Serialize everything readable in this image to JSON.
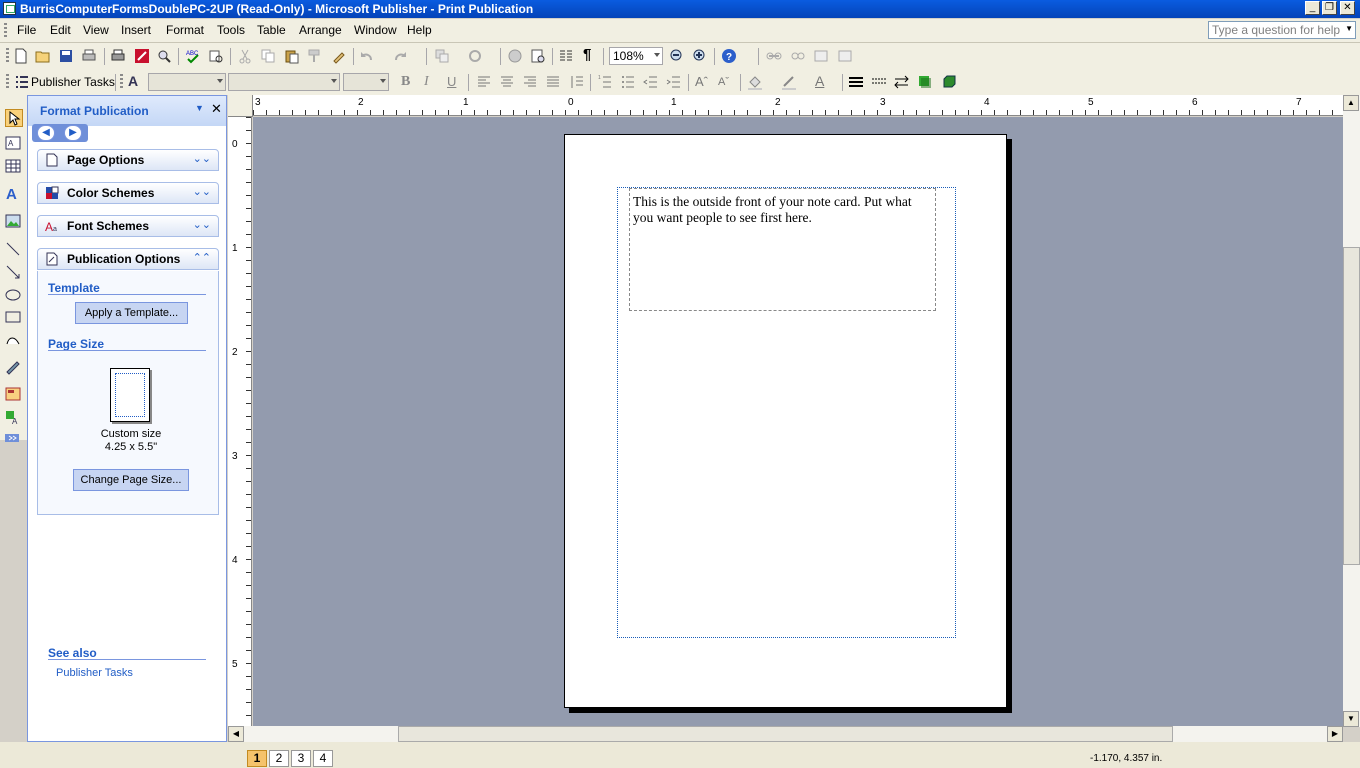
{
  "window": {
    "title": "BurrisComputerFormsDoublePC-2UP (Read-Only) - Microsoft Publisher - Print Publication"
  },
  "menubar": {
    "items": [
      "File",
      "Edit",
      "View",
      "Insert",
      "Format",
      "Tools",
      "Table",
      "Arrange",
      "Window",
      "Help"
    ],
    "help_placeholder": "Type a question for help"
  },
  "toolbar": {
    "zoom": "108%",
    "publisher_tasks_label": "Publisher Tasks"
  },
  "taskpane": {
    "title": "Format Publication",
    "sections": [
      "Page Options",
      "Color Schemes",
      "Font Schemes",
      "Publication Options"
    ],
    "template_heading": "Template",
    "apply_template_label": "Apply a Template...",
    "page_size_heading": "Page Size",
    "size_name": "Custom size",
    "size_dims": "4.25 x 5.5\"",
    "change_size_label": "Change Page Size...",
    "see_also_heading": "See also",
    "publisher_tasks_link": "Publisher Tasks"
  },
  "ruler": {
    "top_labels": [
      "3",
      "2",
      "1",
      "0",
      "1",
      "2",
      "3",
      "4",
      "5",
      "6",
      "7"
    ],
    "left_labels": [
      "0",
      "1",
      "2",
      "3",
      "4",
      "5"
    ]
  },
  "document": {
    "text": "This is the outside front of your note card. Put what you want people to see first here."
  },
  "statusbar": {
    "pages": [
      "1",
      "2",
      "3",
      "4"
    ],
    "active_page": "1",
    "coordinates": "-1.170, 4.357 in."
  },
  "colors": {
    "title_bar": "#0a5ce0",
    "task_link": "#215dc6",
    "workspace": "#939bae"
  }
}
